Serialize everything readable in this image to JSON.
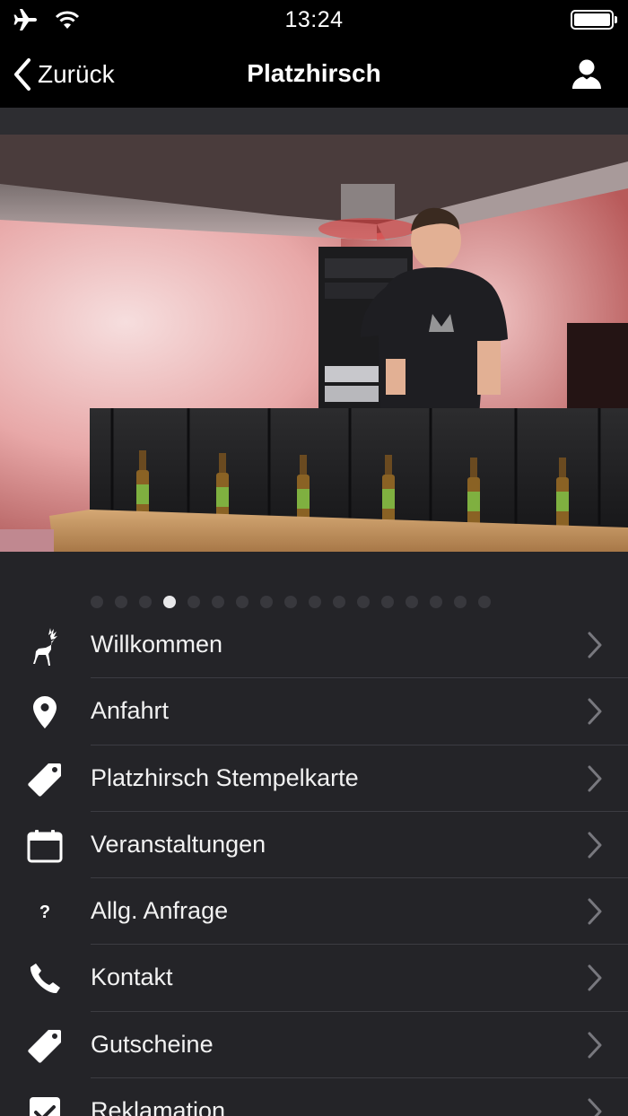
{
  "status_bar": {
    "time": "13:24"
  },
  "nav": {
    "back_label": "Zurück",
    "title": "Platzhirsch"
  },
  "hero": {
    "total_slides": 17,
    "active_index": 3
  },
  "menu": [
    {
      "icon": "deer-icon",
      "label": "Willkommen"
    },
    {
      "icon": "location-pin-icon",
      "label": "Anfahrt"
    },
    {
      "icon": "tag-icon",
      "label": "Platzhirsch Stempelkarte"
    },
    {
      "icon": "calendar-icon",
      "label": "Veranstaltungen"
    },
    {
      "icon": "question-icon",
      "label": "Allg. Anfrage",
      "glyph": "?"
    },
    {
      "icon": "phone-icon",
      "label": "Kontakt"
    },
    {
      "icon": "tag-icon",
      "label": "Gutscheine"
    },
    {
      "icon": "checkbox-icon",
      "label": "Reklamation"
    }
  ]
}
